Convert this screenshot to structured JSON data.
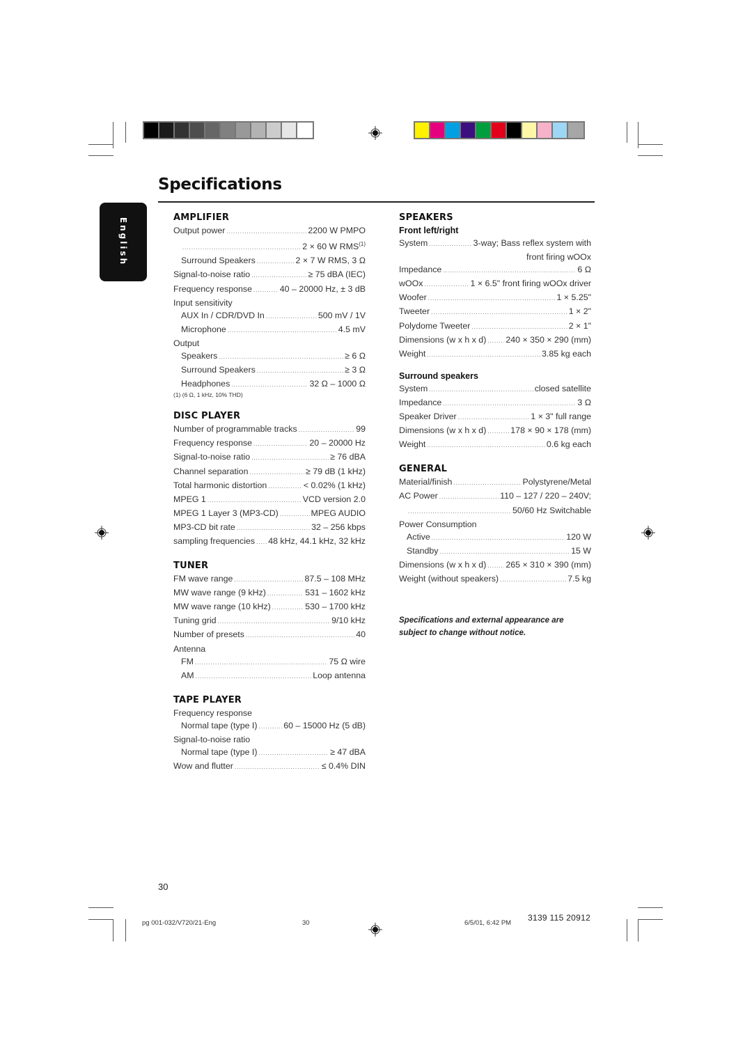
{
  "page": {
    "title": "Specifications",
    "language_tab": "English",
    "page_number": "30"
  },
  "print_marks": {
    "gray_swatches": [
      "#000000",
      "#1b1b1b",
      "#333333",
      "#4d4d4d",
      "#666666",
      "#808080",
      "#999999",
      "#b3b3b3",
      "#cccccc",
      "#e6e6e6",
      "#ffffff"
    ],
    "color_swatches": [
      "#fff200",
      "#e6007e",
      "#00a0e3",
      "#3b0f7e",
      "#009e3d",
      "#e2001a",
      "#000000",
      "#fff7a8",
      "#f5b2c8",
      "#9ed6f5",
      "#a6a6a6"
    ]
  },
  "left_column": {
    "amplifier": {
      "title": "AMPLIFIER",
      "rows": [
        {
          "label": "Output power",
          "value": "2200 W PMPO"
        },
        {
          "label": "",
          "value": "2 × 60 W RMS",
          "sup": "(1)"
        },
        {
          "label": "Surround Speakers",
          "value": "2 × 7 W RMS,  3 Ω"
        },
        {
          "label": "Signal-to-noise ratio",
          "value": "≥ 75 dBA (IEC)"
        },
        {
          "label": "Frequency response",
          "value": "40 – 20000 Hz, ± 3 dB"
        }
      ],
      "input_sensitivity_label": "Input sensitivity",
      "input_rows": [
        {
          "label": "AUX In / CDR/DVD In",
          "value": "500 mV / 1V"
        },
        {
          "label": "Microphone",
          "value": "4.5 mV"
        }
      ],
      "output_label": "Output",
      "output_rows": [
        {
          "label": "Speakers",
          "value": "≥ 6 Ω"
        },
        {
          "label": "Surround Speakers",
          "value": "≥ 3 Ω"
        },
        {
          "label": "Headphones",
          "value": "32 Ω – 1000 Ω"
        }
      ],
      "footnote": "(1) (6 Ω, 1 kHz, 10% THD)"
    },
    "disc_player": {
      "title": "DISC PLAYER",
      "rows": [
        {
          "label": "Number of programmable tracks",
          "value": "99"
        },
        {
          "label": "Frequency response",
          "value": "20 – 20000 Hz"
        },
        {
          "label": "Signal-to-noise ratio",
          "value": "≥ 76 dBA"
        },
        {
          "label": "Channel separation",
          "value": "≥ 79 dB (1 kHz)"
        },
        {
          "label": "Total harmonic distortion",
          "value": "< 0.02% (1 kHz)"
        },
        {
          "label": "MPEG 1",
          "value": "VCD version 2.0"
        },
        {
          "label": "MPEG 1 Layer 3 (MP3-CD)",
          "value": "MPEG AUDIO"
        },
        {
          "label": "MP3-CD bit rate",
          "value": "32 – 256 kbps"
        },
        {
          "label": "sampling frequencies",
          "value": "48 kHz, 44.1 kHz, 32 kHz"
        }
      ]
    },
    "tuner": {
      "title": "TUNER",
      "rows": [
        {
          "label": "FM wave range",
          "value": "87.5 – 108 MHz"
        },
        {
          "label": "MW wave range (9 kHz)",
          "value": "531 – 1602 kHz"
        },
        {
          "label": "MW wave range (10 kHz)",
          "value": "530 – 1700 kHz"
        },
        {
          "label": "Tuning grid",
          "value": "9/10 kHz"
        },
        {
          "label": "Number of presets",
          "value": "40"
        }
      ],
      "antenna_label": "Antenna",
      "antenna_rows": [
        {
          "label": "FM",
          "value": "75 Ω wire"
        },
        {
          "label": "AM",
          "value": "Loop antenna"
        }
      ]
    },
    "tape_player": {
      "title": "TAPE PLAYER",
      "freq_label": "Frequency response",
      "freq_row": {
        "label": "Normal tape (type I)",
        "value": "60 – 15000 Hz (5 dB)"
      },
      "snr_label": "Signal-to-noise ratio",
      "snr_row": {
        "label": "Normal tape (type I)",
        "value": "≥ 47 dBA"
      },
      "wow_row": {
        "label": "Wow and flutter",
        "value": "≤ 0.4% DIN"
      }
    }
  },
  "right_column": {
    "speakers": {
      "title": "SPEAKERS",
      "front_title": "Front left/right",
      "system_row": {
        "label": "System",
        "value": "3-way; Bass reflex system with"
      },
      "system_cont": "front firing wOOx",
      "rows": [
        {
          "label": "Impedance",
          "value": "6 Ω"
        },
        {
          "label": "wOOx",
          "value": "1 × 6.5\" front firing wOOx driver"
        },
        {
          "label": "Woofer",
          "value": "1 × 5.25\""
        },
        {
          "label": "Tweeter",
          "value": "1 × 2\""
        },
        {
          "label": "Polydome Tweeter",
          "value": "2 × 1\""
        },
        {
          "label": "Dimensions (w x h x d)",
          "value": "240 × 350 × 290 (mm)"
        },
        {
          "label": "Weight",
          "value": "3.85 kg each"
        }
      ],
      "surround_title": "Surround speakers",
      "surround_rows": [
        {
          "label": "System",
          "value": "closed satellite"
        },
        {
          "label": "Impedance",
          "value": "3 Ω"
        },
        {
          "label": "Speaker Driver",
          "value": "1 × 3\" full range"
        },
        {
          "label": "Dimensions (w x h x d)",
          "value": "178 × 90 × 178 (mm)"
        },
        {
          "label": "Weight",
          "value": "0.6 kg each"
        }
      ]
    },
    "general": {
      "title": "GENERAL",
      "rows": [
        {
          "label": "Material/finish",
          "value": "Polystyrene/Metal"
        },
        {
          "label": "AC Power",
          "value": "110 – 127 / 220 – 240V;"
        },
        {
          "label": "",
          "value": "50/60 Hz Switchable"
        }
      ],
      "power_label": "Power Consumption",
      "power_rows": [
        {
          "label": "Active",
          "value": "120 W"
        },
        {
          "label": "Standby",
          "value": "15 W"
        }
      ],
      "rows2": [
        {
          "label": "Dimensions (w x h x d)",
          "value": "265 × 310 × 390 (mm)"
        },
        {
          "label": "Weight (without speakers)",
          "value": "7.5 kg"
        }
      ]
    },
    "notice": "Specifications and external appearance are subject to change without notice."
  },
  "footer": {
    "file": "pg 001-032/V720/21-Eng",
    "page": "30",
    "date": "6/5/01, 6:42 PM",
    "code": "3139 115 20912"
  }
}
